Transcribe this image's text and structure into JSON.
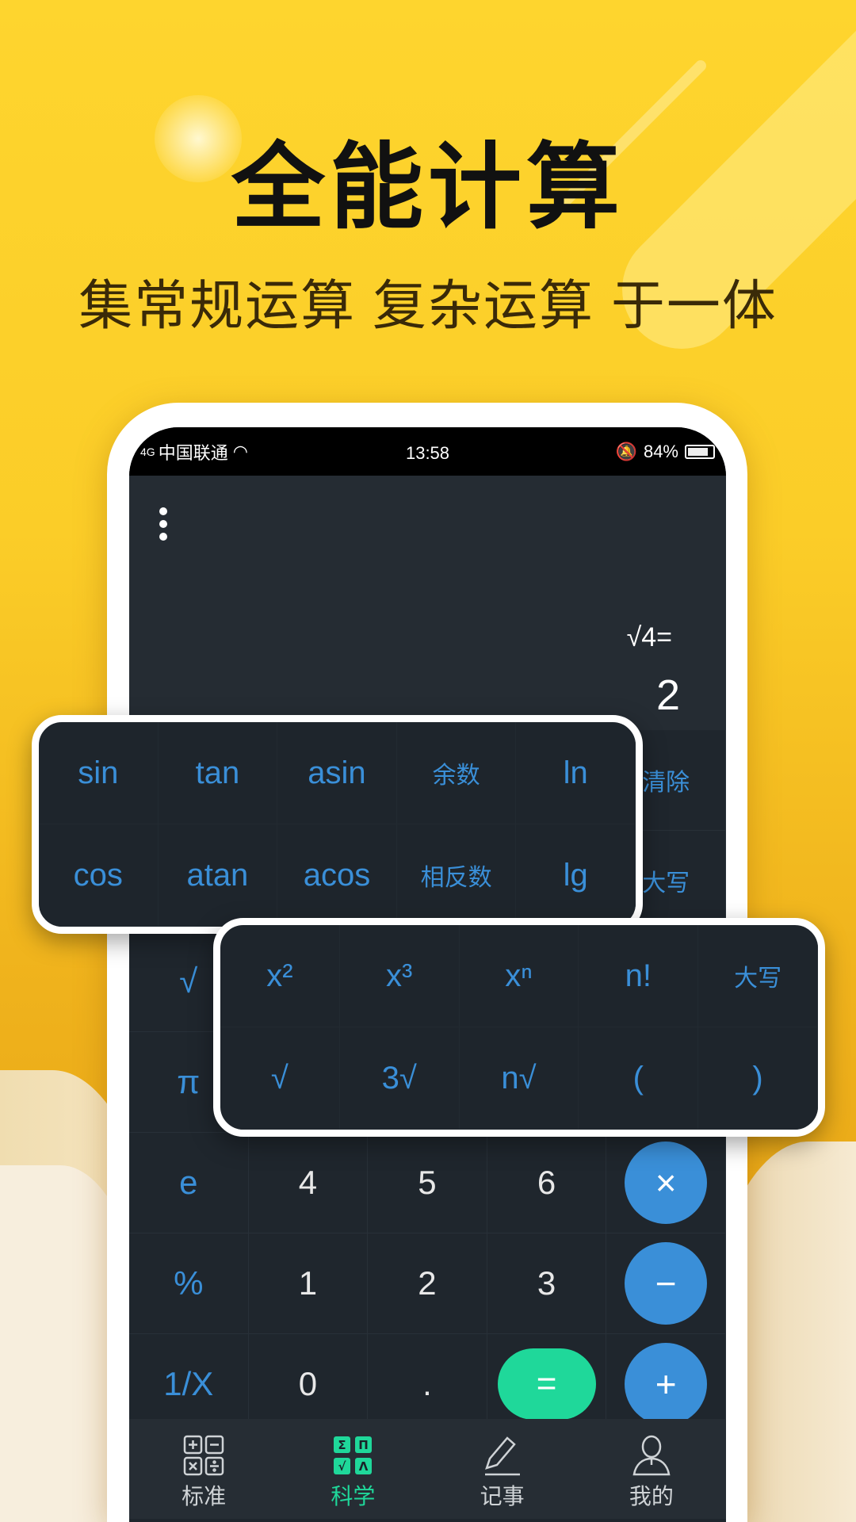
{
  "promo": {
    "title": "全能计算",
    "subtitle": "集常规运算 复杂运算 于一体"
  },
  "status_bar": {
    "network": "4G",
    "carrier": "中国联通",
    "time": "13:58",
    "battery": "84%",
    "battery_level": 0.84
  },
  "display": {
    "expression": "√4=",
    "result": "2"
  },
  "keypad": {
    "rows": [
      [
        "",
        "",
        "",
        "",
        "清除"
      ],
      [
        "",
        "",
        "",
        "",
        "大写"
      ],
      [
        "√",
        "",
        "",
        "",
        ""
      ],
      [
        "π",
        "",
        "",
        "",
        ""
      ],
      [
        "e",
        "4",
        "5",
        "6",
        "×"
      ],
      [
        "%",
        "1",
        "2",
        "3",
        "−"
      ],
      [
        "1/X",
        "0",
        ".",
        "=",
        "+"
      ]
    ]
  },
  "trig_panel": {
    "keys": [
      "sin",
      "tan",
      "asin",
      "余数",
      "ln",
      "cos",
      "atan",
      "acos",
      "相反数",
      "lg"
    ]
  },
  "power_panel": {
    "keys": [
      "x²",
      "x³",
      "xⁿ",
      "n!",
      "大写",
      "√",
      "3√",
      "n√",
      "(",
      ")"
    ]
  },
  "tabs": [
    {
      "label": "标准",
      "icon": "calculator-icon"
    },
    {
      "label": "科学",
      "icon": "science-icon",
      "active": true
    },
    {
      "label": "记事",
      "icon": "pencil-icon"
    },
    {
      "label": "我的",
      "icon": "user-icon"
    }
  ],
  "colors": {
    "accent_blue": "#3a8fd8",
    "accent_green": "#1fd89a",
    "background_yellow": "#fed52e"
  }
}
